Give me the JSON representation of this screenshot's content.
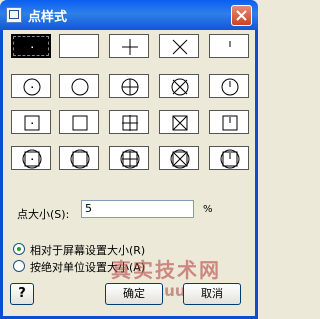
{
  "window": {
    "title": "点样式",
    "icon": "app-window-icon",
    "close_icon": "close-icon"
  },
  "point_styles": {
    "rows": [
      [
        "dot",
        "none",
        "plus",
        "x",
        "tick"
      ],
      [
        "circle-dot",
        "circle",
        "circle-plus",
        "circle-x",
        "circle-tick"
      ],
      [
        "square-dot",
        "square",
        "square-plus",
        "square-x",
        "square-tick"
      ],
      [
        "circle-square-dot",
        "circle-square",
        "circle-square-plus",
        "circle-square-x",
        "circle-square-tick"
      ]
    ],
    "selected": "dot"
  },
  "point_size": {
    "label": "点大小(S):",
    "value": "5",
    "unit": "%"
  },
  "size_mode": {
    "relative_label": "相对于屏幕设置大小(R)",
    "absolute_label": "按绝对单位设置大小(A)",
    "selected": "relative"
  },
  "buttons": {
    "help": "?",
    "ok": "确定",
    "cancel": "取消"
  },
  "watermark": {
    "line1": "真实技术网",
    "line2": "chvscuum.com"
  }
}
